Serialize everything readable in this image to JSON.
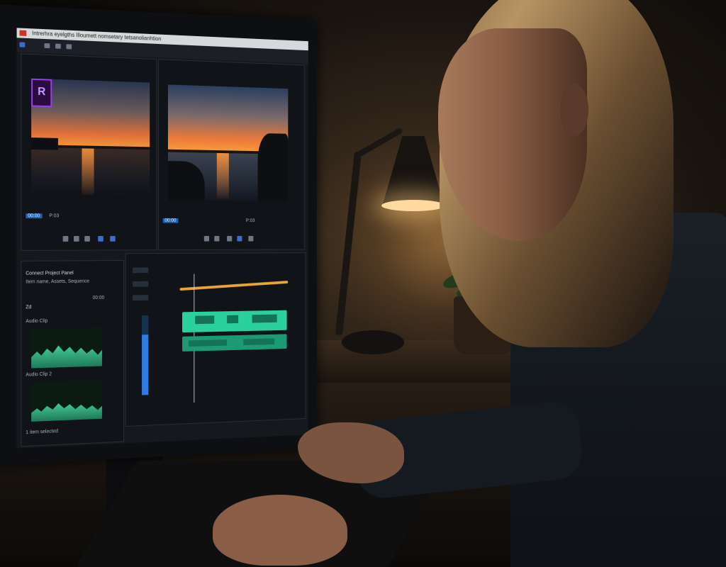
{
  "window": {
    "title": "Intrerhra eyelgths Illoumett nomsetary tetsanolianhtion"
  },
  "source_viewer": {
    "logo": "R",
    "timecode": "00:00",
    "label": "P:03"
  },
  "program_viewer": {
    "timecode": "00:00",
    "label": "P:03"
  },
  "project_panel": {
    "title": "Connect Project Panel",
    "subtitle": "Item name, Assets, Sequence",
    "row_a": "Zd",
    "row_a_value": "00:00",
    "item_1": "Audio Clip",
    "item_2": "Audio Clip 2",
    "footer": "1 item selected"
  },
  "timeline": {
    "audio_level": 0.76
  },
  "colors": {
    "accent": "#1e5fb4",
    "clip": "#2bd19a",
    "marker": "#e9a53a",
    "logo": "#9a3cf0"
  }
}
